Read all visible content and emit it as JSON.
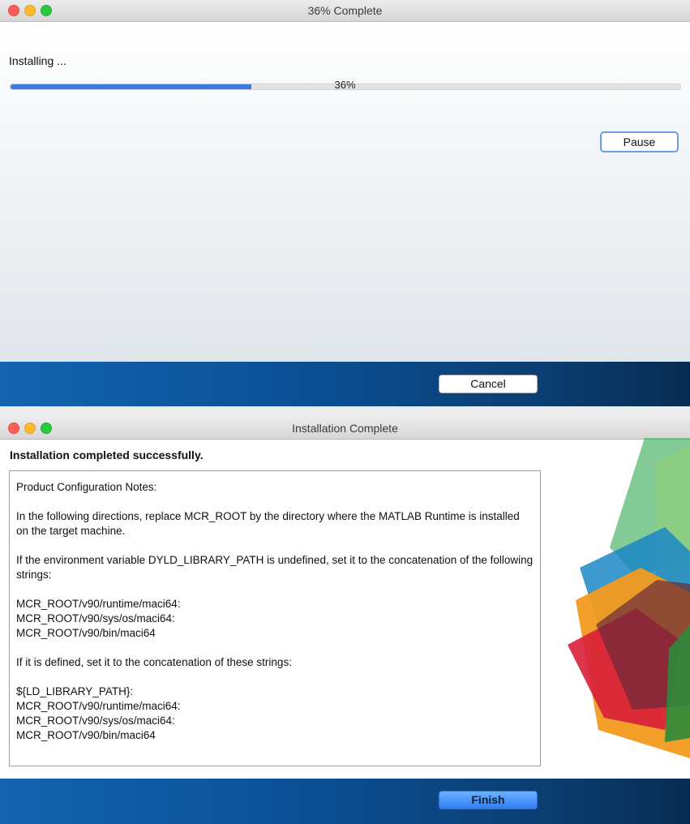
{
  "install_window": {
    "title": "36% Complete",
    "status_label": "Installing ...",
    "progress_percent": 36,
    "progress_label": "36%",
    "pause_label": "Pause",
    "cancel_label": "Cancel"
  },
  "complete_window": {
    "title": "Installation Complete",
    "heading": "Installation completed successfully.",
    "notes": {
      "header": "Product Configuration Notes:",
      "para1": "In the following directions, replace MCR_ROOT by the directory where the MATLAB Runtime is installed on the target machine.",
      "para2": "If the environment variable DYLD_LIBRARY_PATH is undefined, set it to the concatenation of the following strings:",
      "undefined_paths": [
        "MCR_ROOT/v90/runtime/maci64:",
        "MCR_ROOT/v90/sys/os/maci64:",
        "MCR_ROOT/v90/bin/maci64"
      ],
      "para3": "If it is defined, set it to the concatenation of these strings:",
      "defined_paths": [
        "${LD_LIBRARY_PATH}:",
        "MCR_ROOT/v90/runtime/maci64:",
        "MCR_ROOT/v90/sys/os/maci64:",
        "MCR_ROOT/v90/bin/maci64"
      ]
    },
    "finish_label": "Finish"
  },
  "colors": {
    "progress_fill": "#3a7be0",
    "footer_blue": "#0b4f95"
  }
}
